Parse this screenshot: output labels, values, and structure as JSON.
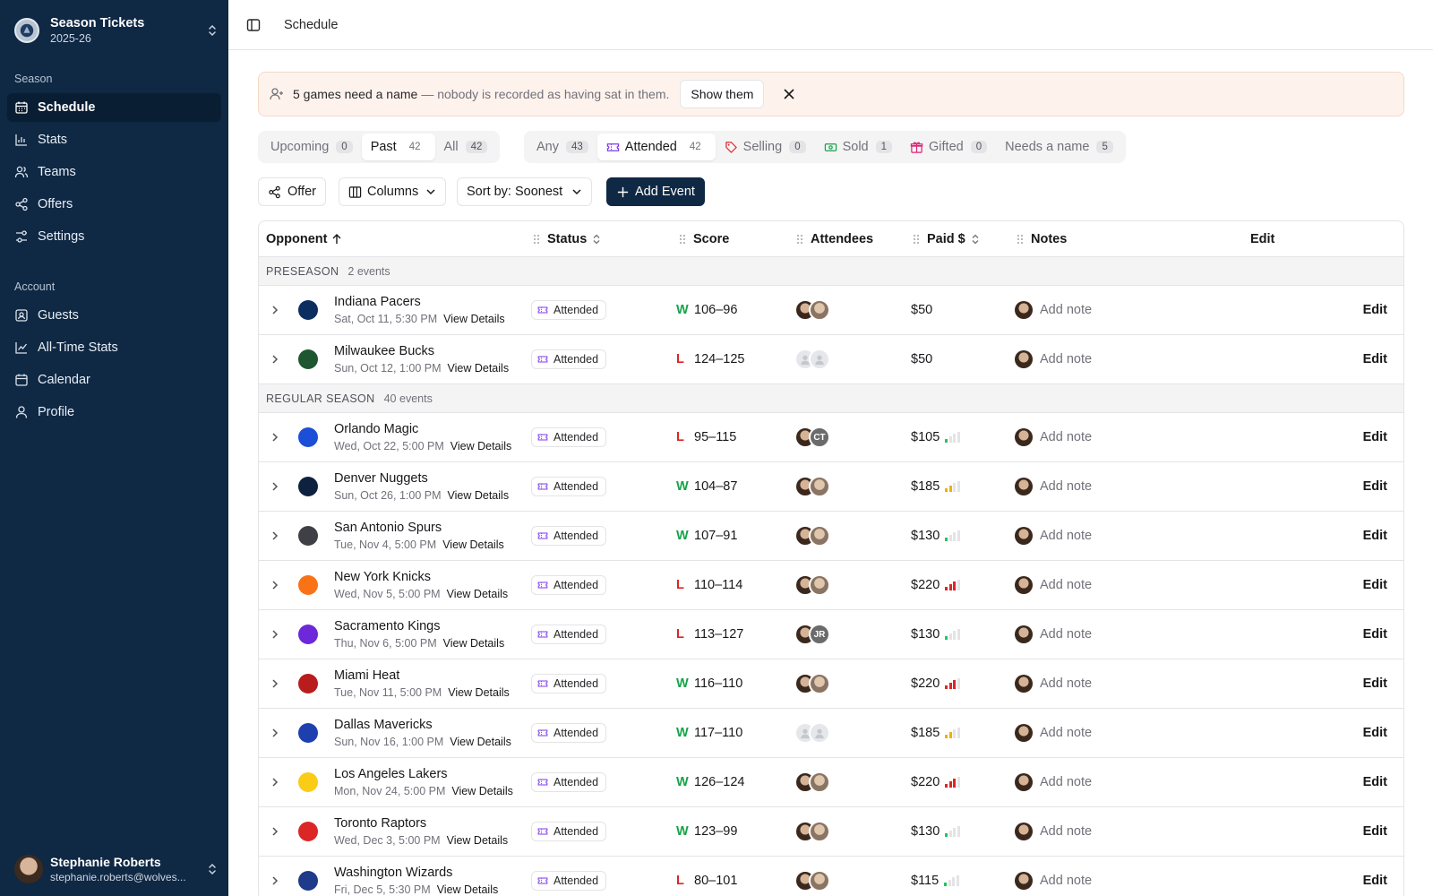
{
  "sidebar": {
    "org_title": "Season Tickets",
    "org_subtitle": "2025-26",
    "section_season": "Season",
    "section_account": "Account",
    "season_items": [
      {
        "label": "Schedule",
        "icon": "calendar-grid-icon",
        "active": true
      },
      {
        "label": "Stats",
        "icon": "bar-chart-icon"
      },
      {
        "label": "Teams",
        "icon": "users-icon"
      },
      {
        "label": "Offers",
        "icon": "share-icon"
      },
      {
        "label": "Settings",
        "icon": "sliders-icon"
      }
    ],
    "account_items": [
      {
        "label": "Guests",
        "icon": "contact-icon"
      },
      {
        "label": "All-Time Stats",
        "icon": "line-chart-icon"
      },
      {
        "label": "Calendar",
        "icon": "calendar-icon"
      },
      {
        "label": "Profile",
        "icon": "user-icon"
      }
    ],
    "user": {
      "name": "Stephanie Roberts",
      "email": "stephanie.roberts@wolves..."
    }
  },
  "topbar": {
    "breadcrumb": "Schedule"
  },
  "banner": {
    "strong": "5 games need a name",
    "muted": "— nobody is recorded as having sat in them.",
    "button": "Show them"
  },
  "tabs_time": [
    {
      "label": "Upcoming",
      "count": "0"
    },
    {
      "label": "Past",
      "count": "42",
      "active": true
    },
    {
      "label": "All",
      "count": "42"
    }
  ],
  "tabs_status": [
    {
      "label": "Any",
      "count": "43"
    },
    {
      "label": "Attended",
      "count": "42",
      "active": true,
      "icon": "ticket-icon",
      "color": "#7c3aed"
    },
    {
      "label": "Selling",
      "count": "0",
      "icon": "tag-icon",
      "color": "#dc2626"
    },
    {
      "label": "Sold",
      "count": "1",
      "icon": "cash-icon",
      "color": "#16a34a"
    },
    {
      "label": "Gifted",
      "count": "0",
      "icon": "gift-icon",
      "color": "#db2777"
    },
    {
      "label": "Needs a name",
      "count": "5"
    }
  ],
  "toolbar": {
    "offer": "Offer",
    "columns": "Columns",
    "sort": "Sort by: Soonest",
    "add": "Add Event"
  },
  "table": {
    "headers": {
      "opponent": "Opponent",
      "status": "Status",
      "score": "Score",
      "attendees": "Attendees",
      "paid": "Paid $",
      "notes": "Notes",
      "edit": "Edit"
    },
    "view_details": "View Details",
    "add_note": "Add note",
    "edit_label": "Edit",
    "groups": [
      {
        "name": "PRESEASON",
        "count": "2 events",
        "rows": [
          {
            "team": "Indiana Pacers",
            "date": "Sat, Oct 11, 5:30 PM",
            "status": "Attended",
            "result": "W",
            "score": "106–96",
            "attendees": [
              "p1",
              "p2"
            ],
            "paid": "$50",
            "tier": 0,
            "logo": "#0c2d60"
          },
          {
            "team": "Milwaukee Bucks",
            "date": "Sun, Oct 12, 1:00 PM",
            "status": "Attended",
            "result": "L",
            "score": "124–125",
            "attendees": [
              "empty",
              "empty"
            ],
            "paid": "$50",
            "tier": 0,
            "logo": "#1e5631"
          }
        ]
      },
      {
        "name": "REGULAR SEASON",
        "count": "40 events",
        "rows": [
          {
            "team": "Orlando Magic",
            "date": "Wed, Oct 22, 5:00 PM",
            "status": "Attended",
            "result": "L",
            "score": "95–115",
            "attendees": [
              "p1",
              "CT"
            ],
            "paid": "$105",
            "tier": 1,
            "logo": "#1d4ed8"
          },
          {
            "team": "Denver Nuggets",
            "date": "Sun, Oct 26, 1:00 PM",
            "status": "Attended",
            "result": "W",
            "score": "104–87",
            "attendees": [
              "p1",
              "p2"
            ],
            "paid": "$185",
            "tier": 2,
            "logo": "#0e2240"
          },
          {
            "team": "San Antonio Spurs",
            "date": "Tue, Nov 4, 5:00 PM",
            "status": "Attended",
            "result": "W",
            "score": "107–91",
            "attendees": [
              "p1",
              "p2"
            ],
            "paid": "$130",
            "tier": 1,
            "logo": "#3f3f46"
          },
          {
            "team": "New York Knicks",
            "date": "Wed, Nov 5, 5:00 PM",
            "status": "Attended",
            "result": "L",
            "score": "110–114",
            "attendees": [
              "p1",
              "p2"
            ],
            "paid": "$220",
            "tier": 3,
            "logo": "#f97316"
          },
          {
            "team": "Sacramento Kings",
            "date": "Thu, Nov 6, 5:00 PM",
            "status": "Attended",
            "result": "L",
            "score": "113–127",
            "attendees": [
              "p1",
              "JR"
            ],
            "paid": "$130",
            "tier": 1,
            "logo": "#6d28d9"
          },
          {
            "team": "Miami Heat",
            "date": "Tue, Nov 11, 5:00 PM",
            "status": "Attended",
            "result": "W",
            "score": "116–110",
            "attendees": [
              "p1",
              "p2"
            ],
            "paid": "$220",
            "tier": 3,
            "logo": "#b91c1c"
          },
          {
            "team": "Dallas Mavericks",
            "date": "Sun, Nov 16, 1:00 PM",
            "status": "Attended",
            "result": "W",
            "score": "117–110",
            "attendees": [
              "empty",
              "empty"
            ],
            "paid": "$185",
            "tier": 2,
            "logo": "#1e40af"
          },
          {
            "team": "Los Angeles Lakers",
            "date": "Mon, Nov 24, 5:00 PM",
            "status": "Attended",
            "result": "W",
            "score": "126–124",
            "attendees": [
              "p1",
              "p2"
            ],
            "paid": "$220",
            "tier": 3,
            "logo": "#facc15"
          },
          {
            "team": "Toronto Raptors",
            "date": "Wed, Dec 3, 5:00 PM",
            "status": "Attended",
            "result": "W",
            "score": "123–99",
            "attendees": [
              "p1",
              "p2"
            ],
            "paid": "$130",
            "tier": 1,
            "logo": "#dc2626"
          },
          {
            "team": "Washington Wizards",
            "date": "Fri, Dec 5, 5:30 PM",
            "status": "Attended",
            "result": "L",
            "score": "80–101",
            "attendees": [
              "p1",
              "p2"
            ],
            "paid": "$115",
            "tier": 1,
            "logo": "#1e3a8a"
          }
        ]
      }
    ]
  },
  "colors": {
    "sidebar_bg": "#0f2844",
    "win": "#16a34a",
    "loss": "#dc2626",
    "tier_low": "#22c55e",
    "tier_mid": "#eab308",
    "tier_high": "#dc2626"
  }
}
